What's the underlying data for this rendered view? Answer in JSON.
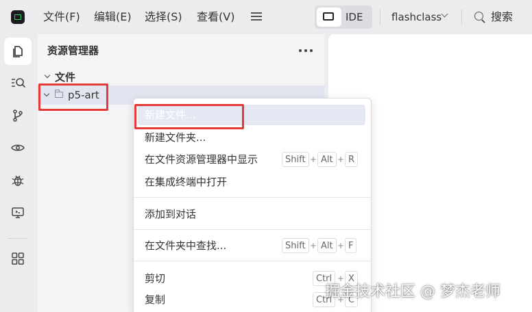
{
  "menu": {
    "file": "文件(F)",
    "edit": "编辑(E)",
    "select": "选择(S)",
    "view": "查看(V)"
  },
  "mode": {
    "ide_label": "IDE"
  },
  "project": {
    "name": "flashclass"
  },
  "search": {
    "label": "搜索"
  },
  "activity_bar": {
    "items": [
      "files-icon",
      "search-code-icon",
      "source-control-icon",
      "preview-icon",
      "debug-icon",
      "remote-display-icon",
      "extensions-icon"
    ]
  },
  "explorer": {
    "title": "资源管理器",
    "section_label": "文件",
    "folder_label": "p5-art"
  },
  "context_menu": {
    "new_file": "新建文件...",
    "new_folder": "新建文件夹...",
    "reveal_in_explorer": "在文件资源管理器中显示",
    "open_in_terminal": "在集成终端中打开",
    "add_to_chat": "添加到对话",
    "find_in_folder": "在文件夹中查找...",
    "cut": "剪切",
    "copy": "复制",
    "shortcuts": {
      "reveal": [
        "Shift",
        "Alt",
        "R"
      ],
      "find": [
        "Shift",
        "Alt",
        "F"
      ],
      "cut": [
        "Ctrl",
        "X"
      ],
      "copy": [
        "Ctrl",
        "C"
      ]
    },
    "plus": "+"
  },
  "watermark": "掘金技术社区 @ 梦杰老师",
  "colors": {
    "highlight_box": "#e53935",
    "hover_row": "#e3e8f3",
    "logo_accent": "#2fd36b"
  }
}
